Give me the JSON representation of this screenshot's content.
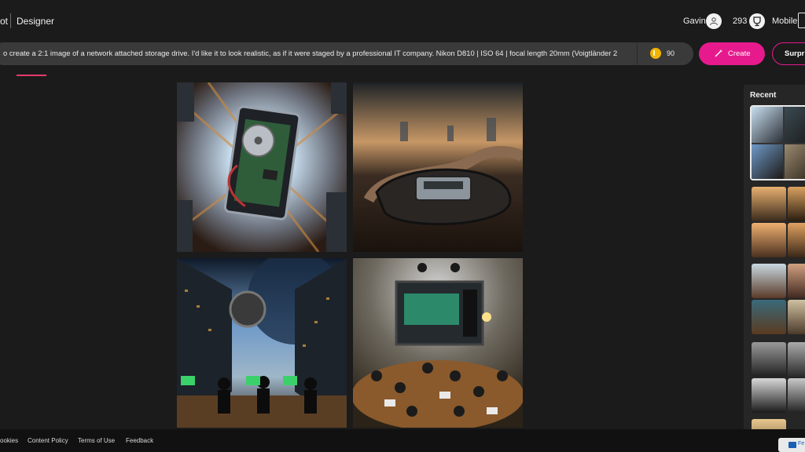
{
  "header": {
    "brand": "ot",
    "product": "Designer",
    "user_name": "Gavin",
    "credits": "293",
    "mobile_label": "Mobile"
  },
  "prompt": {
    "text": "o create a 2:1 image of a network attached storage drive. I'd like it to look realistic, as if it were staged by a professional IT company.  Nikon D810 | ISO 64 | focal length 20mm (Voigtländer 2",
    "boost_count": "90",
    "create_label": "Create",
    "surprise_label": "Surpris"
  },
  "recent": {
    "title": "Recent"
  },
  "footer": {
    "links": [
      "ookies",
      "Content Policy",
      "Terms of Use",
      "Feedback"
    ]
  },
  "colors": {
    "accent": "#e61a8d",
    "background": "#1b1b1b",
    "prompt_bar": "#3a3a3a"
  },
  "icons": {
    "avatar": "user-icon",
    "rewards": "trophy-icon",
    "mobile": "phone-icon",
    "boost": "coin-icon",
    "create": "wand-icon"
  }
}
